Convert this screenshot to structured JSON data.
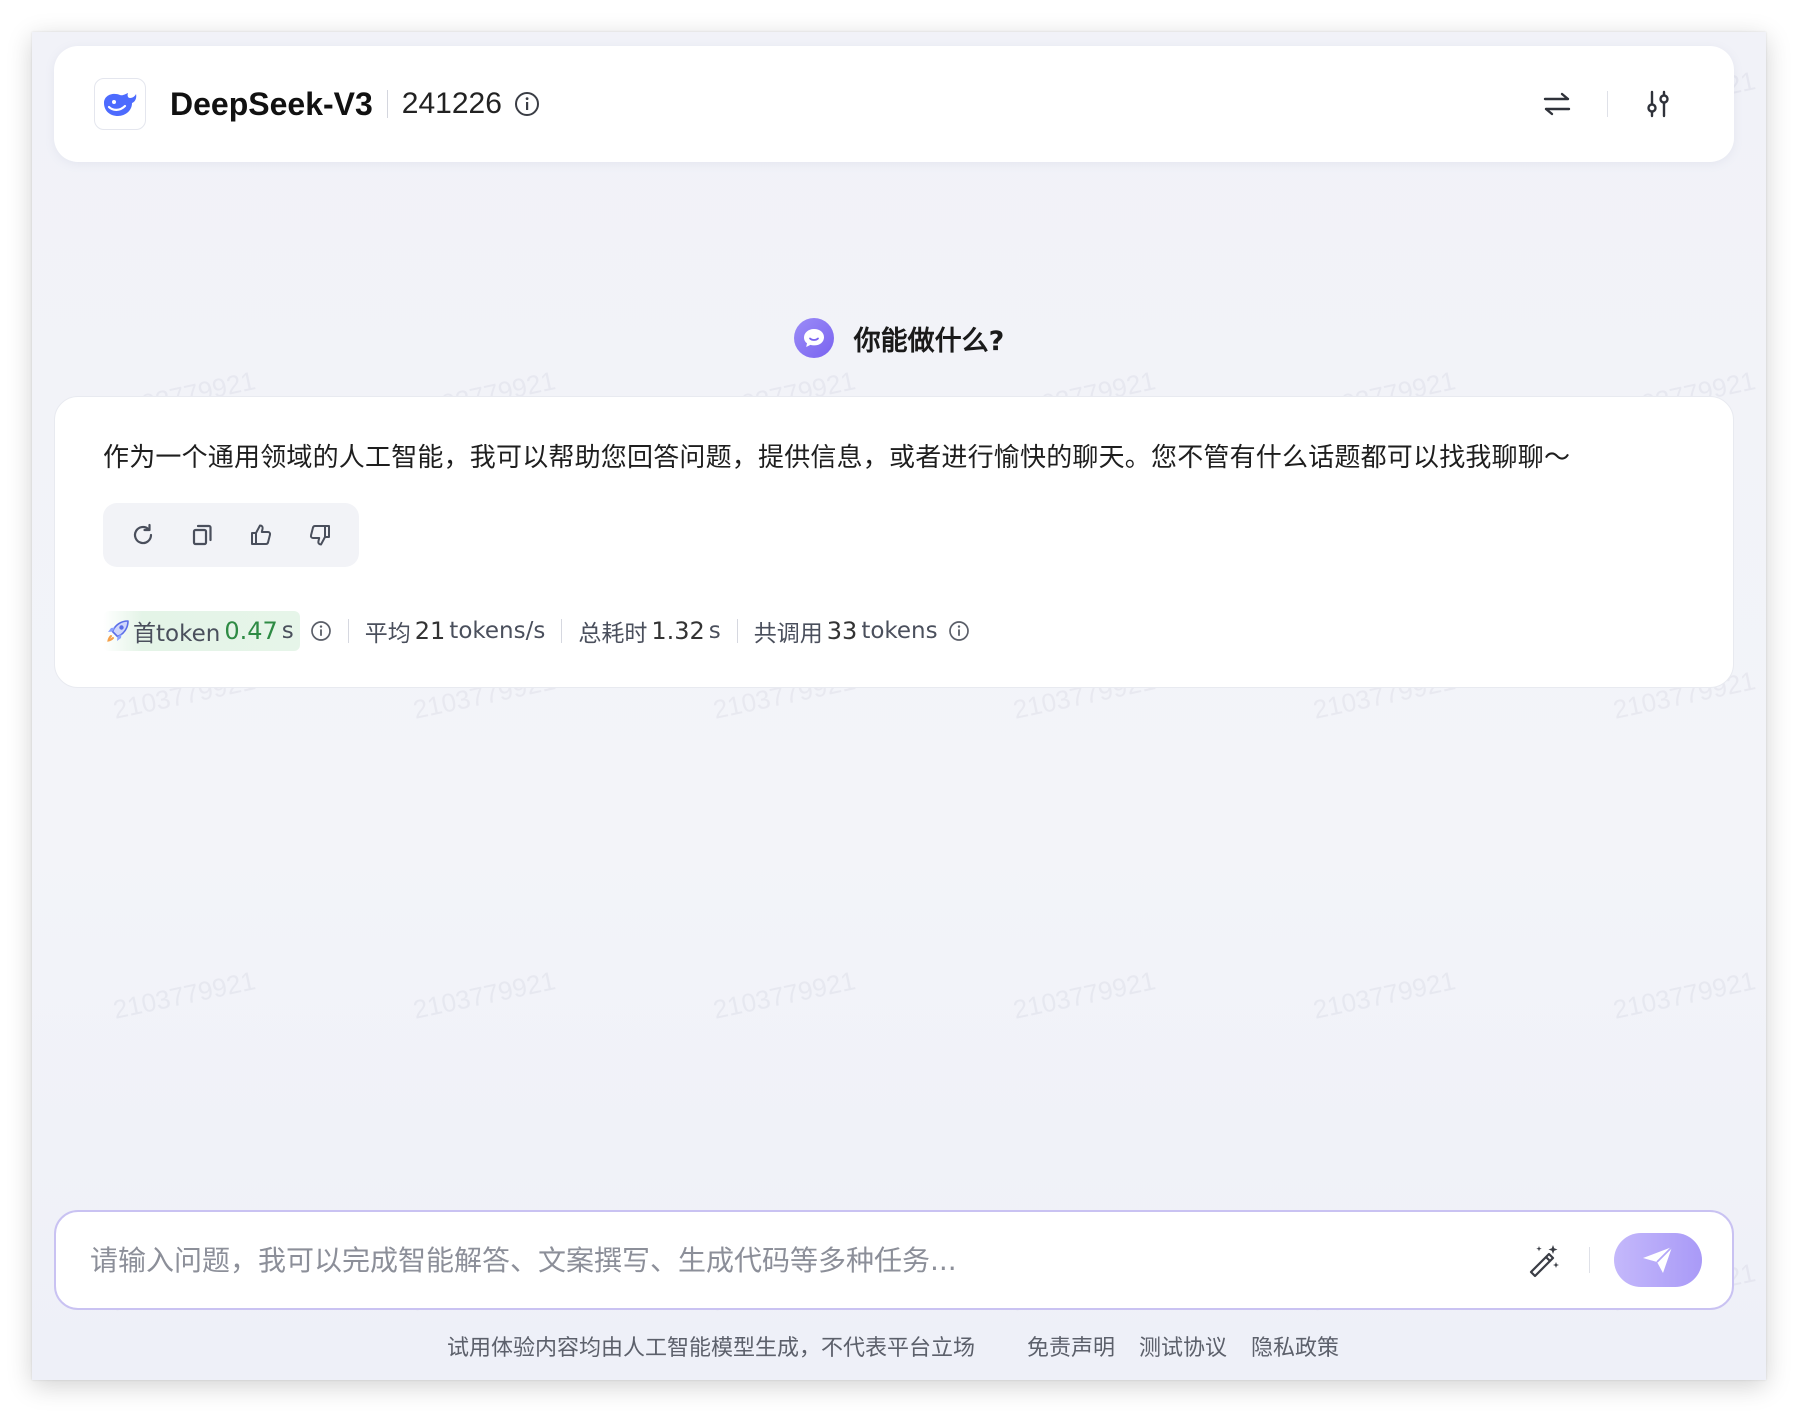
{
  "header": {
    "model_name": "DeepSeek-V3",
    "model_version": "241226",
    "logo_icon": "deepseek-whale-icon",
    "actions": [
      "swap-icon",
      "settings-sliders-icon"
    ]
  },
  "conversation": {
    "question": "你能做什么?",
    "answer": "作为一个通用领域的人工智能，我可以帮助您回答问题，提供信息，或者进行愉快的聊天。您不管有什么话题都可以找我聊聊～",
    "answer_actions": [
      "refresh-icon",
      "copy-icon",
      "thumbs-up-icon",
      "thumbs-down-icon"
    ],
    "stats": {
      "first_token_label": "首token",
      "first_token_value": "0.47",
      "first_token_unit": "s",
      "avg_label": "平均",
      "avg_value": "21",
      "avg_unit": "tokens/s",
      "total_time_label": "总耗时",
      "total_time_value": "1.32",
      "total_time_unit": "s",
      "calls_label": "共调用",
      "calls_value": "33",
      "calls_unit": "tokens"
    }
  },
  "input": {
    "placeholder": "请输入问题，我可以完成智能解答、文案撰写、生成代码等多种任务..."
  },
  "footer": {
    "disclaimer": "试用体验内容均由人工智能模型生成，不代表平台立场",
    "links": [
      "免责声明",
      "测试协议",
      "隐私政策"
    ]
  },
  "watermark": "2103779921",
  "colors": {
    "accent": "#7a63f0",
    "send_gradient_start": "#c4b8fb",
    "send_gradient_end": "#a99af7",
    "first_token_green": "#2e8b44",
    "logo_blue": "#4d6bfe"
  }
}
